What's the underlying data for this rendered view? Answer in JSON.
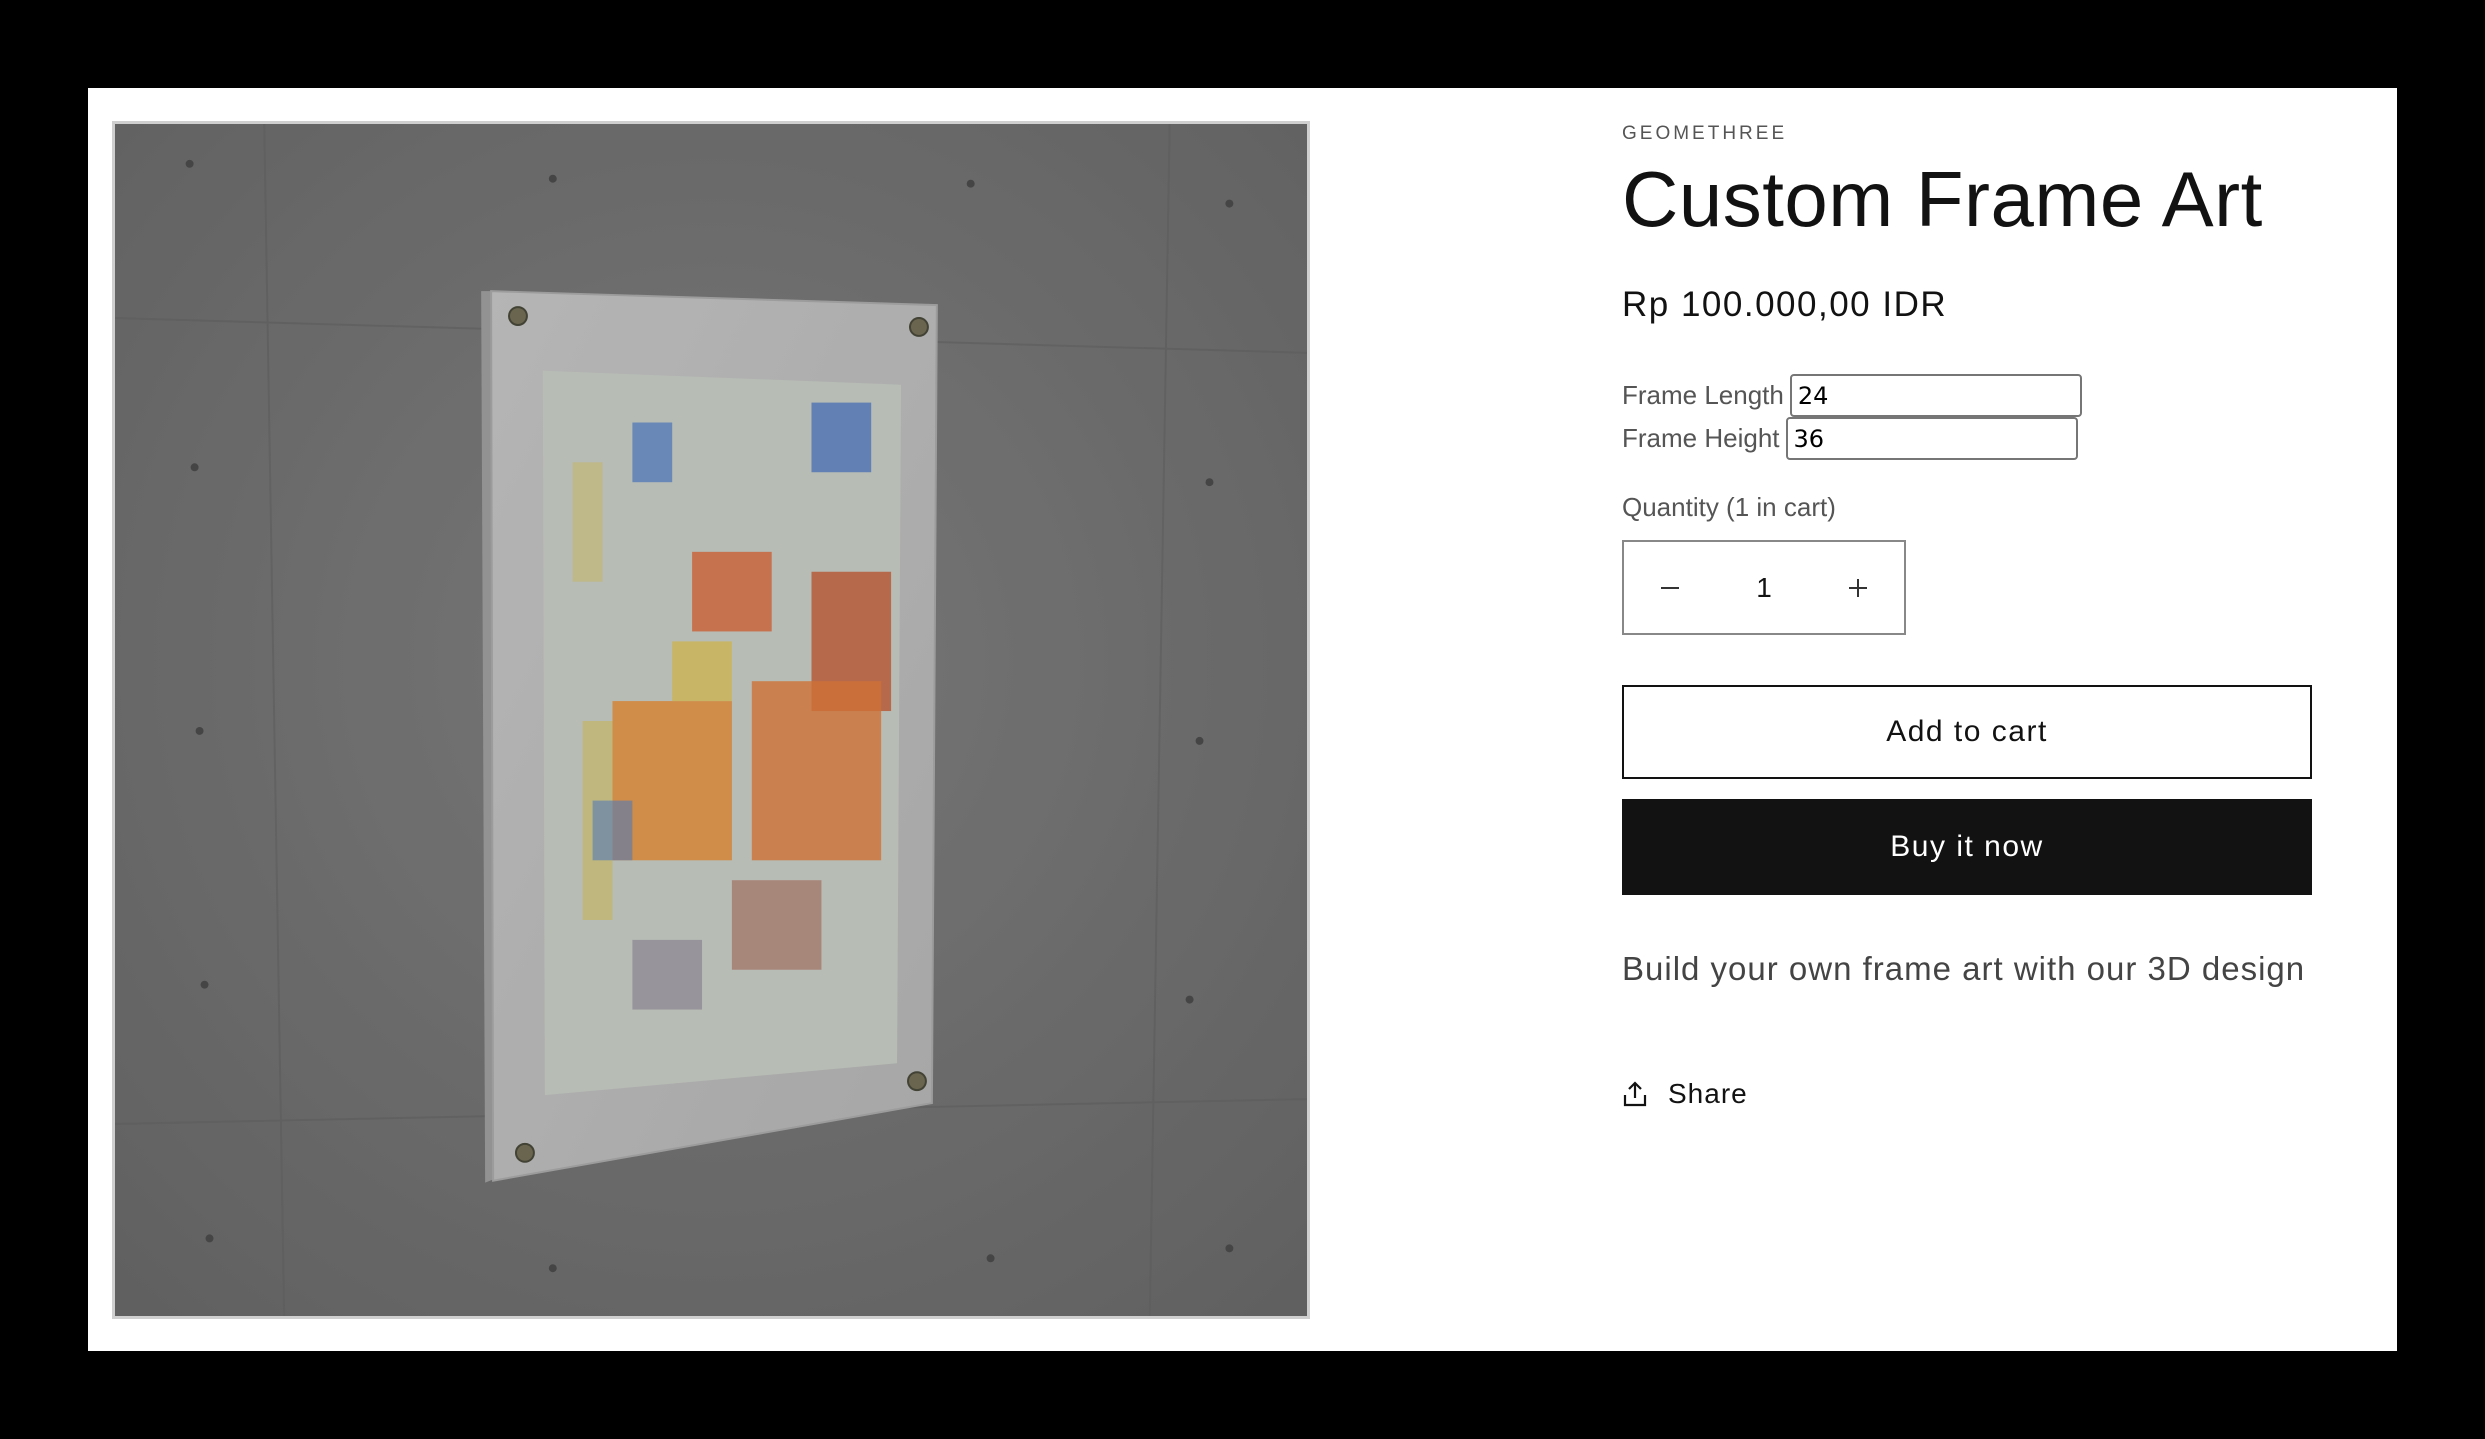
{
  "product": {
    "vendor": "GEOMETHREE",
    "title": "Custom Frame Art",
    "price": "Rp 100.000,00 IDR",
    "description": "Build your own frame art with our 3D design"
  },
  "fields": {
    "length_label": "Frame Length",
    "length_value": "24",
    "height_label": "Frame Height",
    "height_value": "36"
  },
  "quantity": {
    "label": "Quantity (1 in cart)",
    "value": "1",
    "decrease_icon": "minus-icon",
    "increase_icon": "plus-icon"
  },
  "actions": {
    "add_to_cart": "Add to cart",
    "buy_now": "Buy it now",
    "share": "Share",
    "share_icon": "share-upload-icon"
  },
  "colors": {
    "buy_now_bg": "#121212",
    "page_bg": "#ffffff",
    "frame_surround": "#000000"
  }
}
